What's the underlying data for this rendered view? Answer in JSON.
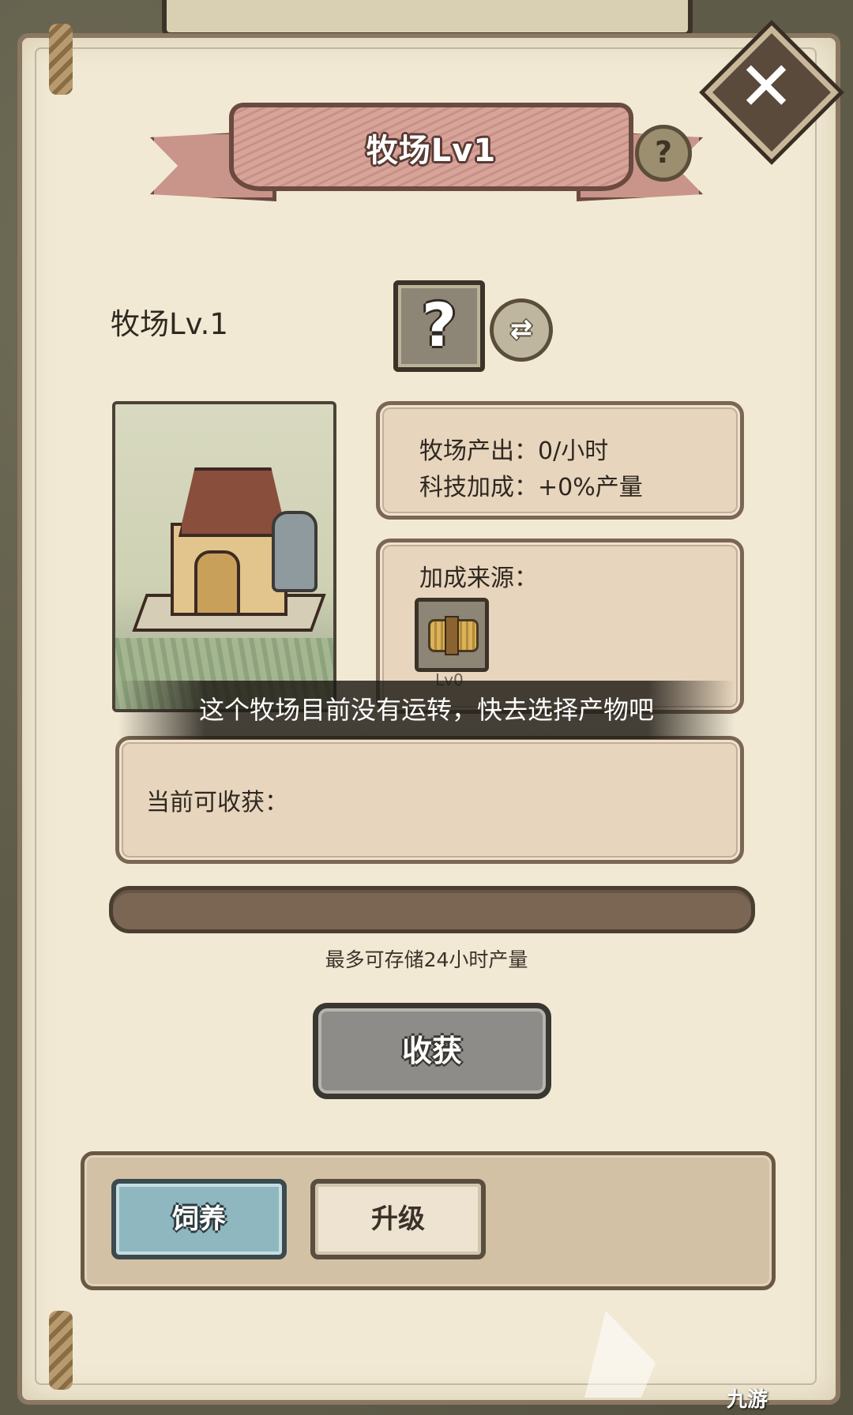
{
  "header": {
    "title": "牧场Lv1",
    "help_icon": "?",
    "close_icon": "✕"
  },
  "building": {
    "level_label": "牧场Lv.1",
    "product_slot_icon": "?",
    "swap_icon": "⇄"
  },
  "stats": {
    "output": "牧场产出：0/小时",
    "tech_bonus": "科技加成：+0%产量"
  },
  "bonus": {
    "title": "加成来源：",
    "items": [
      {
        "icon": "hay-bundle-icon",
        "level": "Lv0"
      }
    ]
  },
  "toast": {
    "message": "这个牧场目前没有运转，快去选择产物吧"
  },
  "harvest": {
    "label": "当前可收获：",
    "progress_fraction": 0,
    "storage_note": "最多可存储24小时产量",
    "button_label": "收获"
  },
  "tabs": {
    "feed_label": "饲养",
    "upgrade_label": "升级",
    "active": "feed"
  },
  "watermark": {
    "brand": "九游"
  },
  "colors": {
    "panel_bg": "#f1e9d4",
    "ribbon": "#c9948a",
    "feed_tab": "#8fb7c0",
    "harvest_button": "#8d8c88"
  }
}
